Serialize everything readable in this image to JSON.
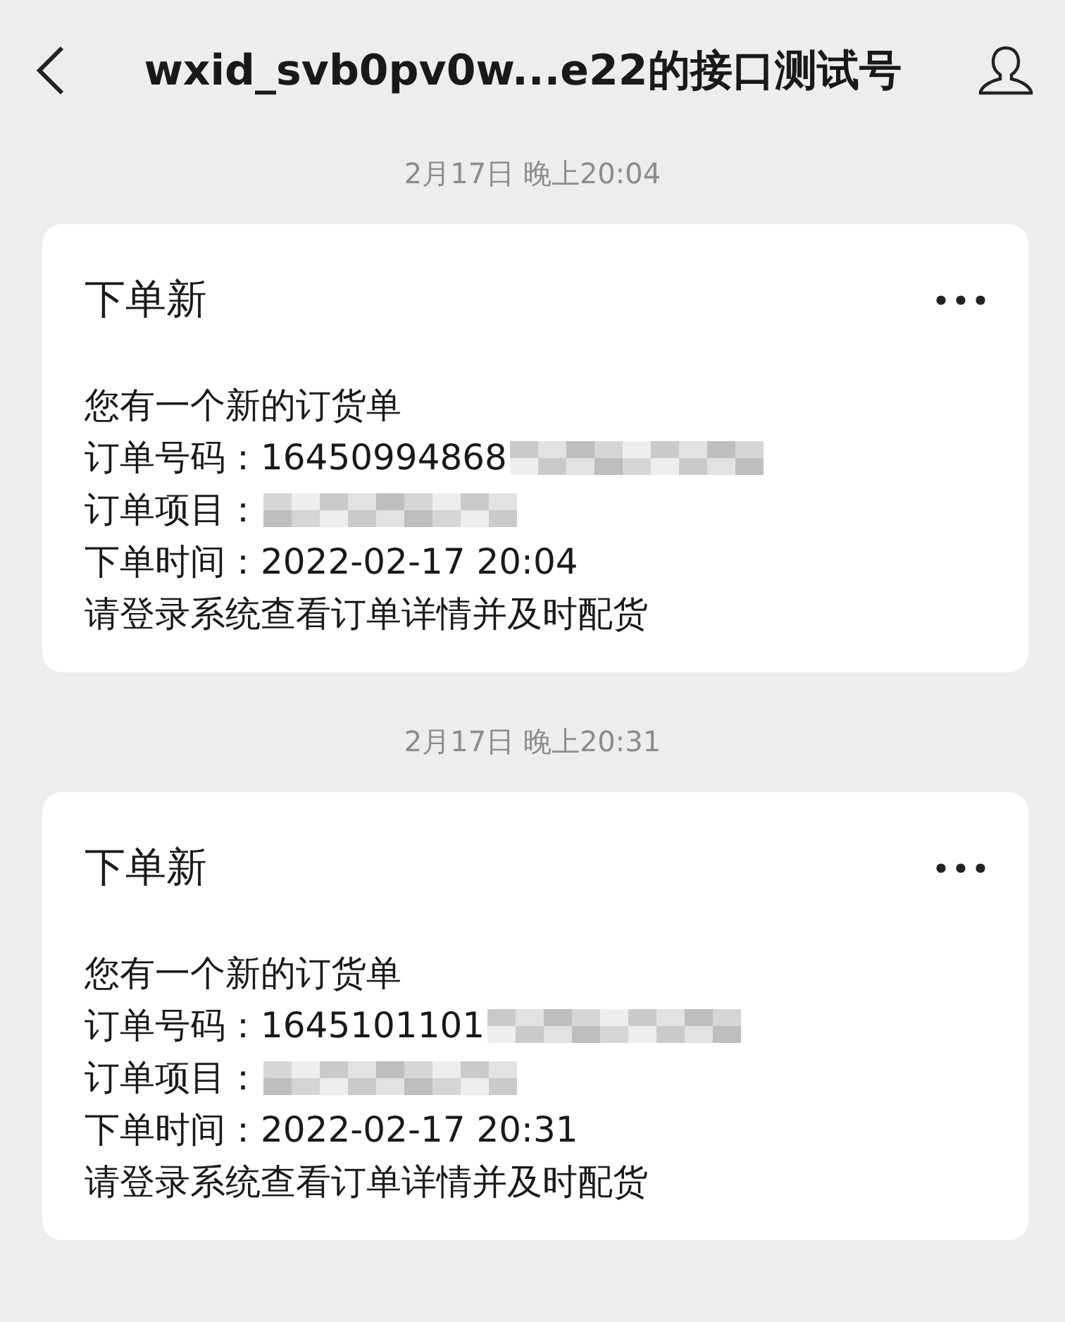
{
  "header": {
    "title": "wxid_svb0pv0w...e22的接口测试号"
  },
  "messages": [
    {
      "time": "2月17日 晚上20:04",
      "card": {
        "title": "下单新",
        "lines": [
          {
            "text": "您有一个新的订货单",
            "redacted": false
          },
          {
            "text": "订单号码：16450994868",
            "redacted": true
          },
          {
            "text": "订单项目：",
            "redacted": true
          },
          {
            "text": "下单时间：2022-02-17 20:04",
            "redacted": false
          },
          {
            "text": "请登录系统查看订单详情并及时配货",
            "redacted": false
          }
        ]
      }
    },
    {
      "time": "2月17日 晚上20:31",
      "card": {
        "title": "下单新",
        "lines": [
          {
            "text": "您有一个新的订货单",
            "redacted": false
          },
          {
            "text": "订单号码：1645101101",
            "redacted": true
          },
          {
            "text": "订单项目：",
            "redacted": true
          },
          {
            "text": "下单时间：2022-02-17 20:31",
            "redacted": false
          },
          {
            "text": "请登录系统查看订单详情并及时配货",
            "redacted": false
          }
        ]
      }
    }
  ]
}
